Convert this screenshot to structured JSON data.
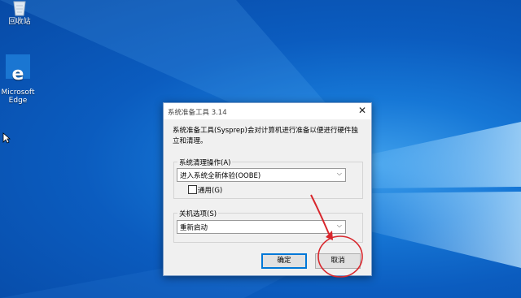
{
  "desktop": {
    "icons": [
      {
        "label": "回收站",
        "icon": "recycle-bin-icon"
      },
      {
        "label": "Microsoft\nEdge",
        "icon": "edge-icon"
      }
    ]
  },
  "dialog": {
    "title": "系统准备工具 3.14",
    "description": "系统准备工具(Sysprep)会对计算机进行准备以便进行硬件独立和清理。",
    "cleanup_group": {
      "label": "系统清理操作(A)",
      "selected": "进入系统全新体验(OOBE)",
      "generalize_label": "通用(G)",
      "generalize_checked": false
    },
    "shutdown_group": {
      "label": "关机选项(S)",
      "selected": "重新启动"
    },
    "ok_label": "确定",
    "cancel_label": "取消"
  },
  "colors": {
    "accent": "#0078d7",
    "annotation": "#d8262c"
  }
}
